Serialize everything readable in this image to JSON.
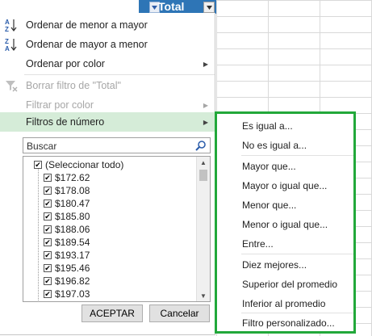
{
  "header": {
    "column_title": "Total"
  },
  "menu": {
    "items": [
      {
        "icon": "sort-ascending-icon",
        "label": "Ordenar de menor a mayor",
        "enabled": true
      },
      {
        "icon": "sort-descending-icon",
        "label": "Ordenar de mayor a menor",
        "enabled": true
      },
      {
        "icon": "",
        "label": "Ordenar por color",
        "enabled": true,
        "has_submenu": true
      },
      {
        "icon": "clear-filter-icon",
        "label": "Borrar filtro de \"Total\"",
        "enabled": false
      },
      {
        "icon": "",
        "label": "Filtrar por color",
        "enabled": false,
        "has_submenu": true
      },
      {
        "icon": "",
        "label": "Filtros de número",
        "enabled": true,
        "has_submenu": true,
        "active": true
      }
    ]
  },
  "search": {
    "placeholder": "Buscar"
  },
  "list": {
    "items": [
      {
        "label": "(Seleccionar todo)",
        "checked": true
      },
      {
        "label": "$172.62",
        "checked": true
      },
      {
        "label": "$178.08",
        "checked": true
      },
      {
        "label": "$180.47",
        "checked": true
      },
      {
        "label": "$185.80",
        "checked": true
      },
      {
        "label": "$188.06",
        "checked": true
      },
      {
        "label": "$189.54",
        "checked": true
      },
      {
        "label": "$193.17",
        "checked": true
      },
      {
        "label": "$195.46",
        "checked": true
      },
      {
        "label": "$196.82",
        "checked": true
      },
      {
        "label": "$197.03",
        "checked": true
      }
    ]
  },
  "buttons": {
    "ok": "ACEPTAR",
    "cancel": "Cancelar"
  },
  "submenu": {
    "items": [
      "Es igual a...",
      "No es igual a...",
      "Mayor que...",
      "Mayor o igual que...",
      "Menor que...",
      "Menor o igual que...",
      "Entre...",
      "Diez mejores...",
      "Superior del promedio",
      "Inferior al promedio",
      "Filtro personalizado..."
    ]
  },
  "colors": {
    "header_blue": "#2e75b6",
    "highlight": "#d5ecd8",
    "submenu_border": "#22a83a"
  }
}
